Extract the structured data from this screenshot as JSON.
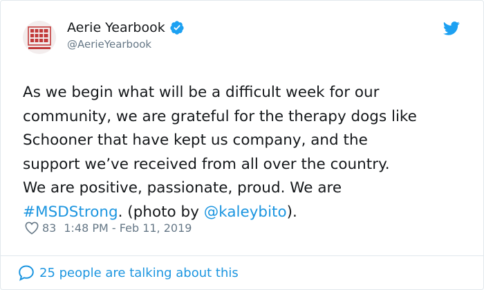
{
  "author": {
    "display_name": "Aerie Yearbook",
    "handle": "@AerieYearbook",
    "avatar_icon": "yearbook-logo-icon",
    "avatar_logo_text": "aerie yearbook",
    "verified": true
  },
  "tweet": {
    "text_parts": {
      "p1": "As we begin what will be a difficult week for our\ncommunity, we are grateful for the therapy dogs like\nSchooner that have kept us company, and the\nsupport we’ve received from all over the country.\nWe are positive, passionate, proud. We are\n",
      "hashtag": "#MSDStrong",
      "p2": ". (photo by ",
      "mention": "@kaleybito",
      "p3": ")."
    }
  },
  "meta": {
    "likes": "83",
    "timestamp": "1:48 PM - Feb 11, 2019"
  },
  "footer": {
    "conversation_label": "25 people are talking about this"
  },
  "colors": {
    "link": "#1b95e0",
    "secondary_text": "#657786",
    "verified_badge": "#1da1f2",
    "avatar_red": "#c23a3a"
  }
}
